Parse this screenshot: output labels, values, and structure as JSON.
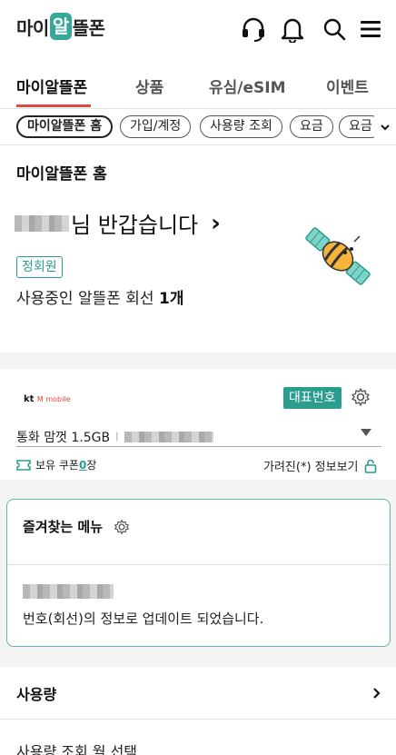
{
  "header": {
    "logo_pre": "마이",
    "logo_hl": "알",
    "logo_post": "뜰폰",
    "icons": [
      "headset-icon",
      "bell-icon",
      "search-icon",
      "menu-icon"
    ]
  },
  "tabs": [
    {
      "label": "마이알뜰폰",
      "active": true
    },
    {
      "label": "상품",
      "active": false
    },
    {
      "label": "유심/eSIM",
      "active": false
    },
    {
      "label": "이벤트",
      "active": false
    }
  ],
  "chips": [
    {
      "label": "마이알뜰폰 홈",
      "active": true
    },
    {
      "label": "가입/계정",
      "active": false
    },
    {
      "label": "사용량 조회",
      "active": false
    },
    {
      "label": "요금",
      "active": false
    },
    {
      "label": "요금",
      "active": false
    }
  ],
  "page": {
    "section_title": "마이알뜰폰 홈"
  },
  "greeting": {
    "text": "님 반갑습니다",
    "chevron": "›",
    "member_badge": "정회원",
    "line_count_prefix": "사용중인 알뜰폰 회선 ",
    "line_count_value": "1개"
  },
  "line_card": {
    "carrier_kt": "kt",
    "carrier_m": "M mobile",
    "rep_badge": "대표번호",
    "plan": "통화 맘껏 1.5GB",
    "plan_sep": "|",
    "coupon_prefix": "보유 쿠폰 ",
    "coupon_count": "0",
    "coupon_suffix": "장",
    "masked_label": "가려진(*) 정보보기"
  },
  "favorites": {
    "title": "즐겨찾는 메뉴",
    "message": "번호(회선)의 정보로 업데이트 되었습니다."
  },
  "usage": {
    "label": "사용량",
    "month_select": "사용량 조회 월 선택"
  },
  "colors": {
    "accent": "#2a9d8f",
    "logo_bg": "#35a89a",
    "tab_underline": "#e8473b"
  }
}
